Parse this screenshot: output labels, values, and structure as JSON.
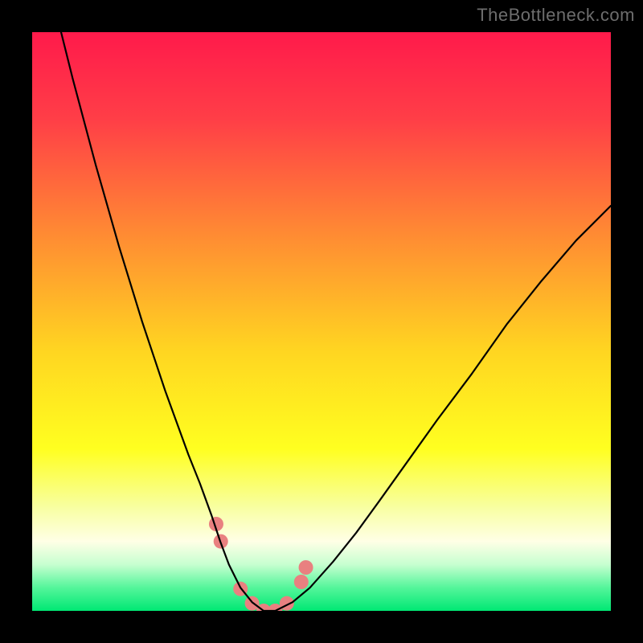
{
  "watermark": {
    "text": "TheBottleneck.com"
  },
  "chart_data": {
    "type": "line",
    "title": "",
    "xlabel": "",
    "ylabel": "",
    "xlim": [
      0,
      100
    ],
    "ylim": [
      0,
      100
    ],
    "grid": false,
    "legend": false,
    "background_gradient_stops": [
      {
        "offset": 0.0,
        "color": "#ff1a4b"
      },
      {
        "offset": 0.15,
        "color": "#ff3e47"
      },
      {
        "offset": 0.35,
        "color": "#ff8b33"
      },
      {
        "offset": 0.55,
        "color": "#ffd521"
      },
      {
        "offset": 0.72,
        "color": "#ffff20"
      },
      {
        "offset": 0.82,
        "color": "#f8ffa0"
      },
      {
        "offset": 0.88,
        "color": "#ffffe6"
      },
      {
        "offset": 0.92,
        "color": "#c6ffd0"
      },
      {
        "offset": 0.96,
        "color": "#54f59a"
      },
      {
        "offset": 1.0,
        "color": "#00e874"
      }
    ],
    "series": [
      {
        "name": "bottleneck-curve",
        "stroke": "#000000",
        "stroke_width": 2.2,
        "x": [
          5,
          7,
          9,
          11,
          13,
          15,
          17,
          19,
          21,
          23,
          25,
          27,
          29,
          31,
          32.5,
          34,
          36,
          38,
          40,
          42,
          45,
          48,
          52,
          56,
          60,
          65,
          70,
          76,
          82,
          88,
          94,
          100
        ],
        "y": [
          100,
          92,
          84.5,
          77,
          70,
          63,
          56.5,
          50,
          44,
          38,
          32.5,
          27,
          22,
          16.5,
          12,
          8,
          4,
          1.5,
          0,
          0,
          1.5,
          4,
          8.5,
          13.5,
          19,
          26,
          33,
          41,
          49.5,
          57,
          64,
          70
        ]
      },
      {
        "name": "highlight-dots",
        "type": "scatter",
        "fill": "#e98080",
        "stroke": "#e98080",
        "radius": 9,
        "x": [
          31.8,
          32.6,
          36.0,
          38.0,
          40.0,
          42.0,
          44.0,
          46.5,
          47.3
        ],
        "y": [
          15.0,
          12.0,
          3.8,
          1.3,
          0.0,
          0.0,
          1.3,
          5.0,
          7.5
        ]
      }
    ]
  }
}
